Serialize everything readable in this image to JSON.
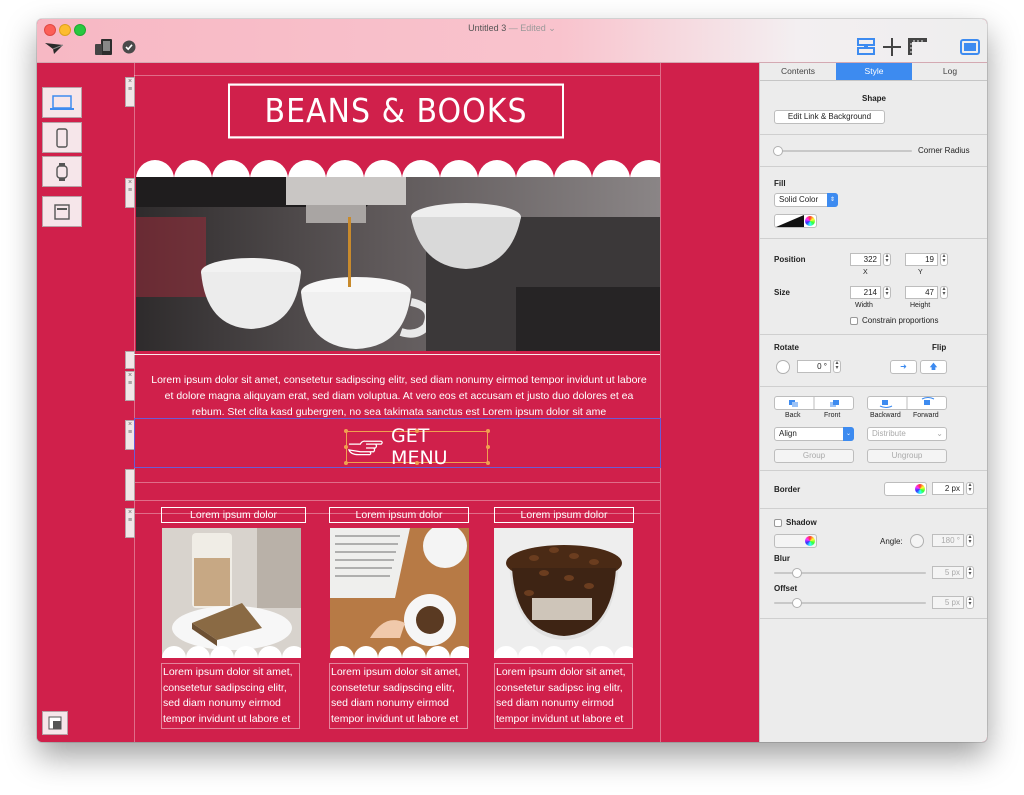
{
  "window": {
    "title": "Untitled 3",
    "edited": "— Edited",
    "edited_chevron": "⌄"
  },
  "canvas": {
    "logo_text": "BEANS & BOOKS",
    "paragraph": "Lorem ipsum dolor sit amet, consetetur sadipscing elitr, sed diam nonumy eirmod tempor invidunt ut labore et dolore magna aliquyam erat, sed diam voluptua. At vero eos et accusam et justo duo dolores et ea rebum. Stet clita kasd gubergren, no sea takimata sanctus est Lorem ipsum dolor sit ame",
    "menu_button": "GET MENU",
    "handle_glyph": "≡",
    "close_glyph": "×",
    "columns": [
      {
        "heading": "Lorem ipsum dolor",
        "text": "Lorem ipsum dolor sit amet, consetetur sadipscing elitr, sed diam nonumy eirmod tempor invidunt ut labore et"
      },
      {
        "heading": "Lorem ipsum dolor",
        "text": "Lorem ipsum dolor sit amet, consetetur sadipscing elitr, sed diam nonumy eirmod tempor invidunt ut labore et"
      },
      {
        "heading": "Lorem ipsum dolor",
        "text": "Lorem ipsum dolor sit amet, consetetur sadipsc ing elitr, sed diam nonumy eirmod tempor invidunt ut labore et"
      }
    ]
  },
  "inspector": {
    "tabs": [
      "Contents",
      "Style",
      "Log"
    ],
    "active_tab": "Style",
    "shape": {
      "title": "Shape",
      "edit_button": "Edit Link & Background",
      "corner_radius_label": "Corner Radius"
    },
    "fill": {
      "title": "Fill",
      "mode": "Solid Color"
    },
    "geometry": {
      "position_label": "Position",
      "x": "322",
      "y": "19",
      "x_label": "X",
      "y_label": "Y",
      "size_label": "Size",
      "width": "214",
      "height": "47",
      "width_label": "Width",
      "height_label": "Height",
      "constrain_label": "Constrain proportions"
    },
    "rotate": {
      "label": "Rotate",
      "value": "0 °",
      "flip_label": "Flip"
    },
    "arrange": {
      "back": "Back",
      "front": "Front",
      "backward": "Backward",
      "forward": "Forward",
      "align": "Align",
      "distribute": "Distribute",
      "group": "Group",
      "ungroup": "Ungroup"
    },
    "border": {
      "label": "Border",
      "value": "2 px"
    },
    "shadow": {
      "label": "Shadow",
      "angle_label": "Angle:",
      "angle_value": "180 °",
      "blur_label": "Blur",
      "blur_value": "5 px",
      "offset_label": "Offset",
      "offset_value": "5 px"
    }
  },
  "colors": {
    "canvas_bg": "#d0204b",
    "accent": "#3d8bf0",
    "selection": "#6b5bd6",
    "handle": "#f0a050"
  }
}
